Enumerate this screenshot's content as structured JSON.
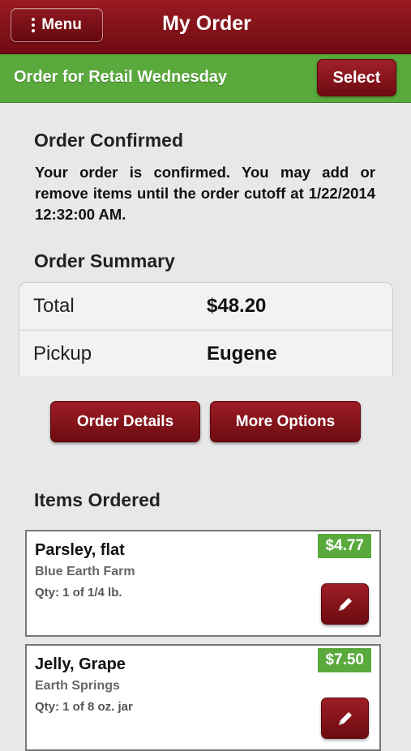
{
  "header": {
    "menu_label": "Menu",
    "title": "My Order"
  },
  "order_bar": {
    "text": "Order for Retail Wednesday",
    "select_label": "Select"
  },
  "confirmation": {
    "heading": "Order Confirmed",
    "message": "Your order is confirmed. You may add or remove items until the order cutoff at 1/22/2014 12:32:00 AM."
  },
  "summary": {
    "heading": "Order Summary",
    "rows": [
      {
        "label": "Total",
        "value": "$48.20"
      },
      {
        "label": "Pickup",
        "value": "Eugene"
      }
    ]
  },
  "actions": {
    "order_details_label": "Order Details",
    "more_options_label": "More Options"
  },
  "items_section": {
    "heading": "Items Ordered",
    "items": [
      {
        "name": "Parsley, flat",
        "farm": "Blue Earth Farm",
        "qty": "Qty: 1 of 1/4 lb.",
        "price": "$4.77"
      },
      {
        "name": "Jelly, Grape",
        "farm": "Earth Springs",
        "qty": "Qty: 1 of 8 oz. jar",
        "price": "$7.50"
      }
    ]
  },
  "colors": {
    "brand_red": "#8a141c",
    "accent_green": "#5aa93c",
    "background": "#e8e8e8"
  },
  "icons": {
    "menu": "kebab-icon",
    "edit": "pencil-icon"
  }
}
